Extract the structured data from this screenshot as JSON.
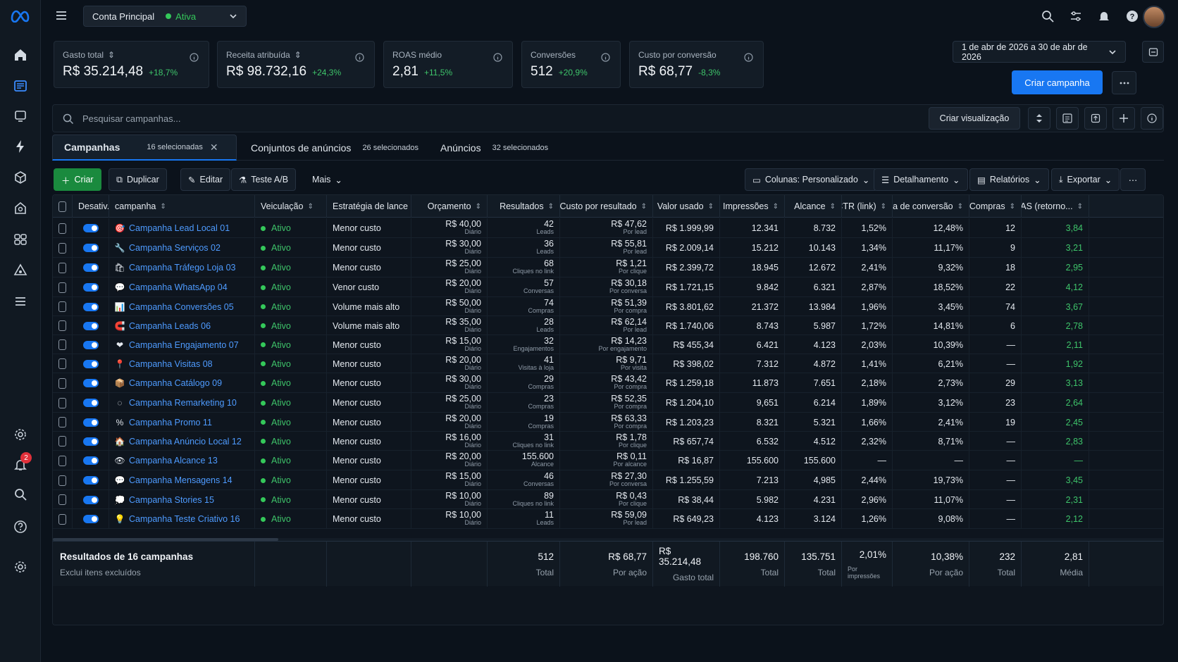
{
  "account": {
    "name": "Conta Principal",
    "status": "Ativa"
  },
  "kpis": [
    {
      "label": "Gasto total",
      "value": "R$ 35.214,48",
      "change": "+18,7%",
      "sortable": true
    },
    {
      "label": "Receita atribuída",
      "value": "R$ 98.732,16",
      "change": "+24,3%",
      "sortable": true
    },
    {
      "label": "ROAS médio",
      "value": "2,81",
      "change": "+11,5%",
      "sortable": false
    },
    {
      "label": "Conversões",
      "value": "512",
      "change": "+20,9%",
      "sortable": false
    },
    {
      "label": "Custo por conversão",
      "value": "R$ 68,77",
      "change": "-8,3%",
      "sortable": false
    }
  ],
  "date_range": "1 de abr de 2026 a 30 de abr de 2026",
  "create_campaign": "Criar campanha",
  "search": {
    "placeholder": "Pesquisar campanhas..."
  },
  "create_view": "Criar visualização",
  "tabs": [
    {
      "label": "Campanhas",
      "selected": "16 selecionadas"
    },
    {
      "label": "Conjuntos de anúncios",
      "selected": "26 selecionados"
    },
    {
      "label": "Anúncios",
      "selected": "32 selecionados"
    }
  ],
  "toolbar": {
    "create": "Criar",
    "duplicate": "Duplicar",
    "edit": "Editar",
    "abtest": "Teste A/B",
    "more": "Mais",
    "columns": "Colunas: Personalizado",
    "breakdown": "Detalhamento",
    "reports": "Relatórios",
    "export": "Exportar"
  },
  "columns": [
    "Desativ.",
    "campanha",
    "Veiculação",
    "Estratégia de lance",
    "Orçamento",
    "Resultados",
    "Custo por resultado",
    "Valor usado",
    "Impressões",
    "Alcance",
    "CTR (link)",
    "Taxa de conversão",
    "Compras",
    "ROAS (retorno..."
  ],
  "rows": [
    {
      "icon": "🎯",
      "name": "Campanha Lead Local 01",
      "status": "Ativo",
      "bid": "Menor custo",
      "budget": "R$ 40,00",
      "budget_sub": "Diário",
      "results": "42",
      "results_sub": "Leads",
      "cpr": "R$ 47,62",
      "cpr_sub": "Por lead",
      "spent": "R$ 1.999,99",
      "impr": "12.341",
      "reach": "8.732",
      "ctr": "1,52%",
      "conv": "12,48%",
      "purchases": "12",
      "roas": "3,84"
    },
    {
      "icon": "🔧",
      "name": "Campanha Serviços 02",
      "status": "Ativo",
      "bid": "Menor custo",
      "budget": "R$ 30,00",
      "budget_sub": "Diário",
      "results": "36",
      "results_sub": "Leads",
      "cpr": "R$ 55,81",
      "cpr_sub": "Por lead",
      "spent": "R$ 2.009,14",
      "impr": "15.212",
      "reach": "10.143",
      "ctr": "1,34%",
      "conv": "11,17%",
      "purchases": "9",
      "roas": "3,21"
    },
    {
      "icon": "🛍",
      "name": "Campanha Tráfego Loja 03",
      "status": "Ativo",
      "bid": "Menor custo",
      "budget": "R$ 25,00",
      "budget_sub": "Diário",
      "results": "68",
      "results_sub": "Cliques no link",
      "cpr": "R$ 1,21",
      "cpr_sub": "Por clique",
      "spent": "R$ 2.399,72",
      "impr": "18.945",
      "reach": "12.672",
      "ctr": "2,41%",
      "conv": "9,32%",
      "purchases": "18",
      "roas": "2,95"
    },
    {
      "icon": "💬",
      "name": "Campanha WhatsApp 04",
      "status": "Ativo",
      "bid": "Venor custo",
      "budget": "R$ 20,00",
      "budget_sub": "Diário",
      "results": "57",
      "results_sub": "Conversas",
      "cpr": "R$ 30,18",
      "cpr_sub": "Por conversa",
      "spent": "R$ 1.721,15",
      "impr": "9.842",
      "reach": "6.321",
      "ctr": "2,87%",
      "conv": "18,52%",
      "purchases": "22",
      "roas": "4,12"
    },
    {
      "icon": "📊",
      "name": "Campanha Conversões 05",
      "status": "Ativo",
      "bid": "Volume mais alto",
      "budget": "R$ 50,00",
      "budget_sub": "Diário",
      "results": "74",
      "results_sub": "Compras",
      "cpr": "R$ 51,39",
      "cpr_sub": "Por compra",
      "spent": "R$ 3.801,62",
      "impr": "21.372",
      "reach": "13.984",
      "ctr": "1,96%",
      "conv": "3,45%",
      "purchases": "74",
      "roas": "3,67"
    },
    {
      "icon": "🧲",
      "name": "Campanha Leads 06",
      "status": "Ativo",
      "bid": "Volume mais alto",
      "budget": "R$ 35,00",
      "budget_sub": "Diário",
      "results": "28",
      "results_sub": "Leads",
      "cpr": "R$ 62,14",
      "cpr_sub": "Por lead",
      "spent": "R$ 1.740,06",
      "impr": "8.743",
      "reach": "5.987",
      "ctr": "1,72%",
      "conv": "14,81%",
      "purchases": "6",
      "roas": "2,78"
    },
    {
      "icon": "❤",
      "name": "Campanha Engajamento 07",
      "status": "Ativo",
      "bid": "Menor custo",
      "budget": "R$ 15,00",
      "budget_sub": "Diário",
      "results": "32",
      "results_sub": "Engajamentos",
      "cpr": "R$ 14,23",
      "cpr_sub": "Por engajamento",
      "spent": "R$ 455,34",
      "impr": "6.421",
      "reach": "4.123",
      "ctr": "2,03%",
      "conv": "10,39%",
      "purchases": "—",
      "roas": "2,11"
    },
    {
      "icon": "📍",
      "name": "Campanha Visitas 08",
      "status": "Ativo",
      "bid": "Menor custo",
      "budget": "R$ 20,00",
      "budget_sub": "Diário",
      "results": "41",
      "results_sub": "Visitas à loja",
      "cpr": "R$ 9,71",
      "cpr_sub": "Por visita",
      "spent": "R$ 398,02",
      "impr": "7.312",
      "reach": "4.872",
      "ctr": "1,41%",
      "conv": "6,21%",
      "purchases": "—",
      "roas": "1,92"
    },
    {
      "icon": "📦",
      "name": "Campanha Catálogo 09",
      "status": "Ativo",
      "bid": "Menor custo",
      "budget": "R$ 30,00",
      "budget_sub": "Diário",
      "results": "29",
      "results_sub": "Compras",
      "cpr": "R$ 43,42",
      "cpr_sub": "Por compra",
      "spent": "R$ 1.259,18",
      "impr": "11.873",
      "reach": "7.651",
      "ctr": "2,18%",
      "conv": "2,73%",
      "purchases": "29",
      "roas": "3,13"
    },
    {
      "icon": "◌",
      "name": "Campanha Remarketing 10",
      "status": "Ativo",
      "bid": "Menor custo",
      "budget": "R$ 25,00",
      "budget_sub": "Diário",
      "results": "23",
      "results_sub": "Compras",
      "cpr": "R$ 52,35",
      "cpr_sub": "Por compra",
      "spent": "R$ 1.204,10",
      "impr": "9,651",
      "reach": "6.214",
      "ctr": "1,89%",
      "conv": "3,12%",
      "purchases": "23",
      "roas": "2,64"
    },
    {
      "icon": "%",
      "name": "Campanha Promo 11",
      "status": "Ativo",
      "bid": "Menor custo",
      "budget": "R$ 20,00",
      "budget_sub": "Diário",
      "results": "19",
      "results_sub": "Compras",
      "cpr": "R$ 63,33",
      "cpr_sub": "Por compra",
      "spent": "R$ 1.203,23",
      "impr": "8.321",
      "reach": "5.321",
      "ctr": "1,66%",
      "conv": "2,41%",
      "purchases": "19",
      "roas": "2,45"
    },
    {
      "icon": "🏠",
      "name": "Campanha Anúncio Local 12",
      "status": "Ativo",
      "bid": "Menor custo",
      "budget": "R$ 16,00",
      "budget_sub": "Diário",
      "results": "31",
      "results_sub": "Cliques no link",
      "cpr": "R$ 1,78",
      "cpr_sub": "Por clique",
      "spent": "R$ 657,74",
      "impr": "6.532",
      "reach": "4.512",
      "ctr": "2,32%",
      "conv": "8,71%",
      "purchases": "—",
      "roas": "2,83"
    },
    {
      "icon": "👁",
      "name": "Campanha Alcance 13",
      "status": "Ativo",
      "bid": "Menor custo",
      "budget": "R$ 20,00",
      "budget_sub": "Diário",
      "results": "155.600",
      "results_sub": "Alcance",
      "cpr": "R$ 0,11",
      "cpr_sub": "Por alcance",
      "spent": "R$ 16,87",
      "impr": "155.600",
      "reach": "155.600",
      "ctr": "—",
      "conv": "—",
      "purchases": "—",
      "roas": "—"
    },
    {
      "icon": "💬",
      "name": "Campanha Mensagens 14",
      "status": "Ativo",
      "bid": "Menor custo",
      "budget": "R$ 15,00",
      "budget_sub": "Diário",
      "results": "46",
      "results_sub": "Conversas",
      "cpr": "R$ 27,30",
      "cpr_sub": "Por conversa",
      "spent": "R$ 1.255,59",
      "impr": "7.213",
      "reach": "4,985",
      "ctr": "2,44%",
      "conv": "19,73%",
      "purchases": "—",
      "roas": "3,45"
    },
    {
      "icon": "💭",
      "name": "Campanha Stories 15",
      "status": "Ativo",
      "bid": "Menor custo",
      "budget": "R$ 10,00",
      "budget_sub": "Diário",
      "results": "89",
      "results_sub": "Cliques no link",
      "cpr": "R$ 0,43",
      "cpr_sub": "Por clique",
      "spent": "R$ 38,44",
      "impr": "5.982",
      "reach": "4.231",
      "ctr": "2,96%",
      "conv": "11,07%",
      "purchases": "—",
      "roas": "2,31"
    },
    {
      "icon": "💡",
      "name": "Campanha Teste Criativo 16",
      "status": "Ativo",
      "bid": "Menor custo",
      "budget": "R$ 10,00",
      "budget_sub": "Diário",
      "results": "11",
      "results_sub": "Leads",
      "cpr": "R$ 59,09",
      "cpr_sub": "Por lead",
      "spent": "R$ 649,23",
      "impr": "4.123",
      "reach": "3.124",
      "ctr": "1,26%",
      "conv": "9,08%",
      "purchases": "—",
      "roas": "2,12"
    }
  ],
  "footer": {
    "title": "Resultados de 16 campanhas",
    "subtitle": "Exclui itens excluídos",
    "results": {
      "v": "512",
      "l": "Total"
    },
    "cpr": {
      "v": "R$ 68,77",
      "l": "Por ação"
    },
    "spent": {
      "v": "R$ 35.214,48",
      "l": "Gasto total"
    },
    "impr": {
      "v": "198.760",
      "l": "Total"
    },
    "reach": {
      "v": "135.751",
      "l": "Total"
    },
    "ctr": {
      "v": "2,01%",
      "l": "Por impressões"
    },
    "conv": {
      "v": "10,38%",
      "l": "Por ação"
    },
    "purchases": {
      "v": "232",
      "l": "Total"
    },
    "roas": {
      "v": "2,81",
      "l": "Média"
    }
  },
  "notifications_count": "2",
  "colors": {
    "accent": "#1877f2",
    "positive": "#3ec46a",
    "link": "#4e9bff"
  }
}
